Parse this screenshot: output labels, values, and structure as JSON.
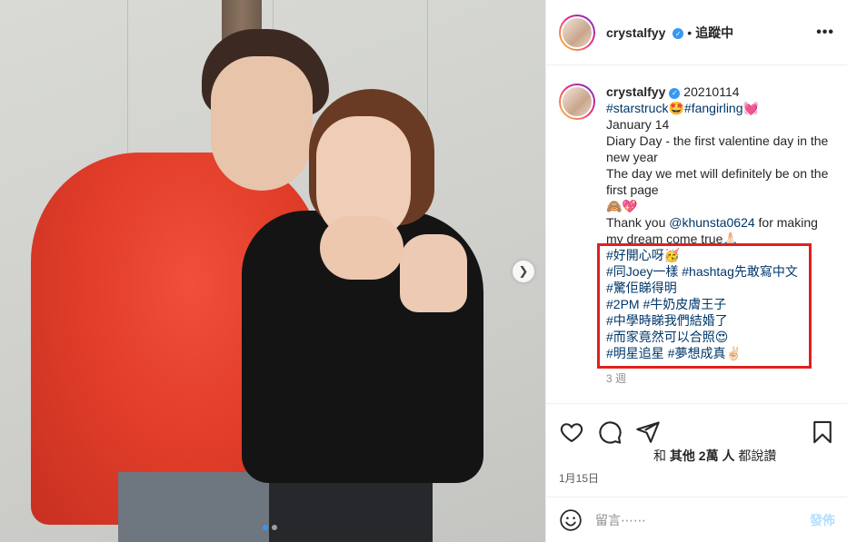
{
  "header": {
    "username": "crystalfyy",
    "separator": "•",
    "follow_status": "追蹤中",
    "more_icon": "more-icon"
  },
  "caption": {
    "username": "crystalfyy",
    "date_tag": "20210114",
    "line1_tag1": "#starstruck",
    "line1_emoji1": "🤩",
    "line1_tag2": "#fangirling",
    "line1_emoji2": "💓",
    "line2": "January 14",
    "line3": "Diary Day - the first valentine day in the new year",
    "line4": "The day we met will definitely be on the first page",
    "line5": "🙈💖",
    "line6_pre": "Thank you ",
    "line6_mention": "@khunsta0624",
    "line6_post": " for making my dream come true🙏🏻",
    "hashtags": [
      "#好開心呀🥳",
      "#同Joey一樣 #hashtag先敢寫中文",
      "#驚佢睇得明",
      "#2PM #牛奶皮膚王子",
      "#中學時睇我們結婚了",
      "#而家竟然可以合照😍",
      "#明星追星 #夢想成真✌🏻"
    ],
    "age": "3 週"
  },
  "likes": {
    "prefix": "和",
    "others": "其他 2萬 人",
    "suffix": "都說讚"
  },
  "post_date": "1月15日",
  "comment": {
    "placeholder": "留言⋯⋯",
    "post_label": "發佈"
  },
  "carousel": {
    "current": 1,
    "total": 2
  },
  "colors": {
    "link": "#00376b",
    "verified": "#3897f0",
    "highlight": "#e02020",
    "post_disabled": "#b2dffc"
  }
}
